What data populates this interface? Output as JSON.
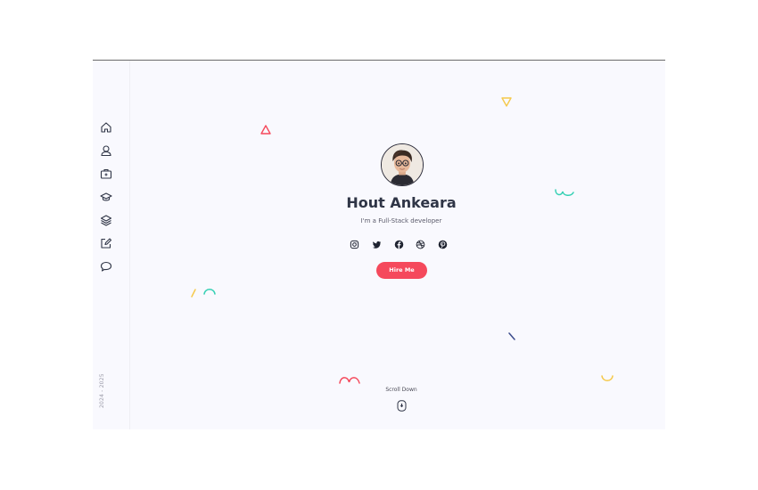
{
  "colors": {
    "accent": "#f5495c",
    "heading": "#2f3546",
    "background": "#f9f9fe",
    "deco_yellow": "#f5c94b",
    "deco_teal": "#36d0b4",
    "deco_red": "#f5495c",
    "deco_navy": "#3b4b8c"
  },
  "sidebar": {
    "items": [
      {
        "icon": "home-icon"
      },
      {
        "icon": "user-icon"
      },
      {
        "icon": "briefcase-icon"
      },
      {
        "icon": "graduation-cap-icon"
      },
      {
        "icon": "layers-icon"
      },
      {
        "icon": "edit-icon"
      },
      {
        "icon": "chat-icon"
      }
    ],
    "year": "2024 - 2025"
  },
  "hero": {
    "name": "Hout Ankeara",
    "subtitle": "I'm a Full-Stack developer",
    "hire_label": "Hire Me",
    "social": [
      "instagram-icon",
      "twitter-icon",
      "facebook-icon",
      "dribbble-icon",
      "pinterest-icon"
    ]
  },
  "scroll": {
    "label": "Scroll Down"
  }
}
